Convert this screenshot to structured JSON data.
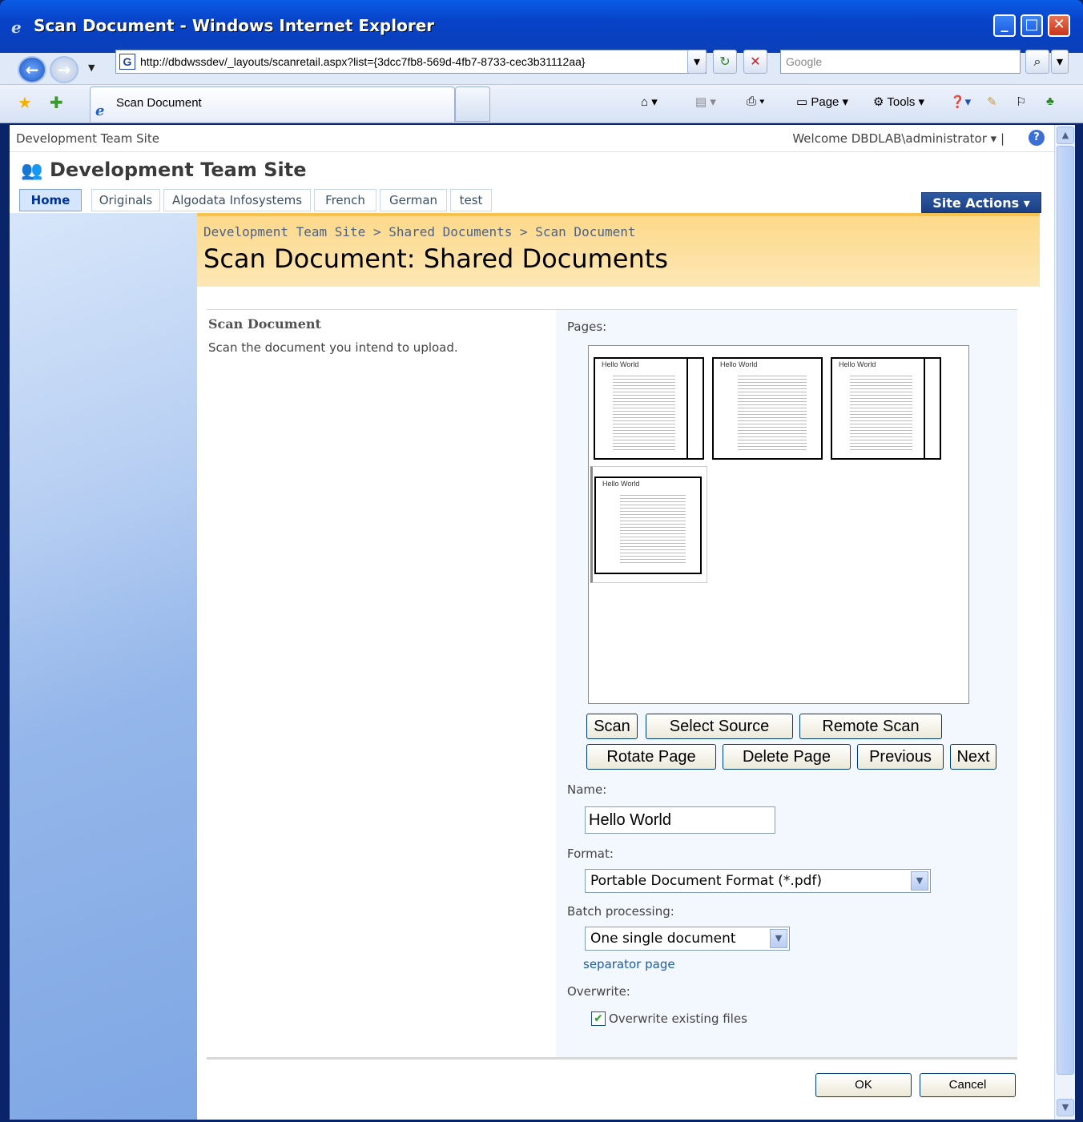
{
  "window": {
    "title": "Scan Document - Windows Internet Explorer"
  },
  "addressbar": {
    "url": "http://dbdwssdev/_layouts/scanretail.aspx?list={3dcc7fb8-569d-4fb7-8733-cec3b31112aa}",
    "search_placeholder": "Google"
  },
  "tabs": {
    "active_title": "Scan Document"
  },
  "commandbar": {
    "page_label": "Page",
    "tools_label": "Tools"
  },
  "sitebar": {
    "site_link": "Development Team Site",
    "welcome": "Welcome DBDLAB\\administrator"
  },
  "site": {
    "title": "Development Team Site"
  },
  "topnav": {
    "items": [
      "Home",
      "Originals",
      "Algodata Infosystems",
      "French",
      "German",
      "test"
    ],
    "site_actions": "Site Actions"
  },
  "breadcrumb": {
    "items": [
      "Development Team Site",
      "Shared Documents",
      "Scan Document"
    ],
    "separator": ">"
  },
  "page": {
    "title": "Scan Document: Shared Documents"
  },
  "form": {
    "section_title": "Scan Document",
    "section_desc": "Scan the document you intend to upload.",
    "pages_label": "Pages:",
    "thumb_title": "Hello World",
    "buttons": {
      "scan": "Scan",
      "select_source": "Select Source",
      "remote_scan": "Remote Scan",
      "rotate": "Rotate Page",
      "delete": "Delete Page",
      "previous": "Previous",
      "next": "Next"
    },
    "name_label": "Name:",
    "name_value": "Hello World",
    "format_label": "Format:",
    "format_value": "Portable Document Format (*.pdf)",
    "batch_label": "Batch processing:",
    "batch_value": "One single document",
    "separator_link": "separator page",
    "overwrite_label": "Overwrite:",
    "overwrite_checkbox": "Overwrite existing files",
    "ok": "OK",
    "cancel": "Cancel"
  }
}
